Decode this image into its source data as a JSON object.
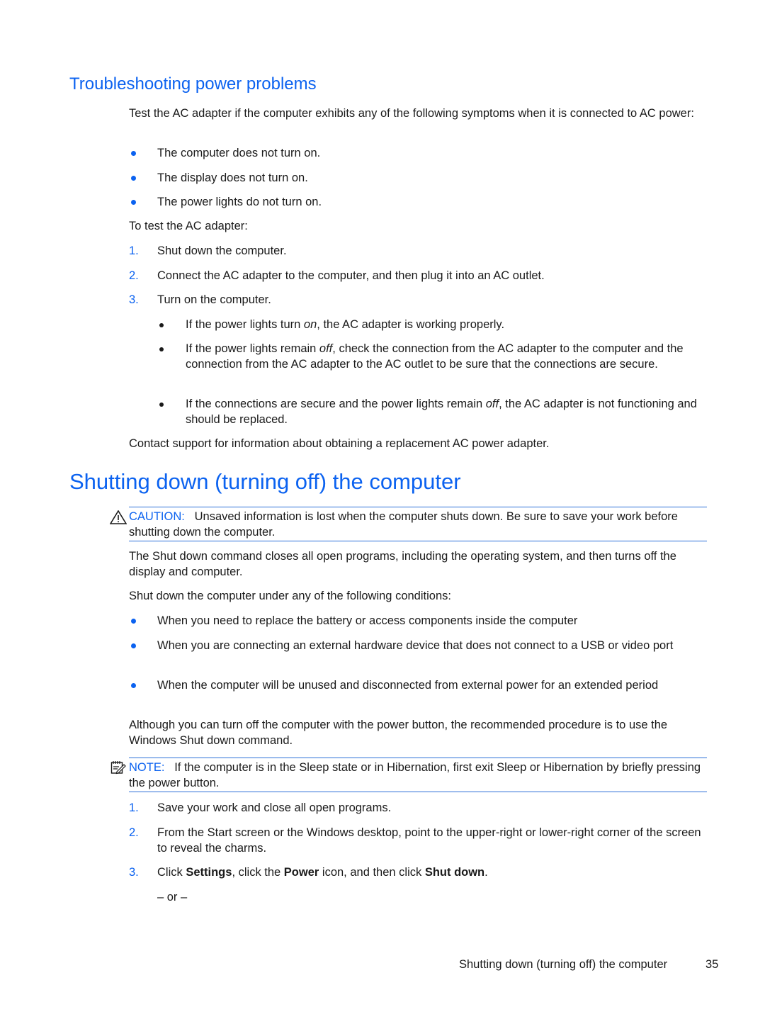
{
  "section_troubleshooting": {
    "heading": "Troubleshooting power problems",
    "intro": "Test the AC adapter if the computer exhibits any of the following symptoms when it is connected to AC power:",
    "symptoms": [
      "The computer does not turn on.",
      "The display does not turn on.",
      "The power lights do not turn on."
    ],
    "test_intro": "To test the AC adapter:",
    "steps": [
      {
        "num": "1.",
        "text": "Shut down the computer."
      },
      {
        "num": "2.",
        "text": "Connect the AC adapter to the computer, and then plug it into an AC outlet."
      },
      {
        "num": "3.",
        "text": "Turn on the computer."
      }
    ],
    "results": [
      {
        "before": "If the power lights turn ",
        "em": "on",
        "after": ", the AC adapter is working properly."
      },
      {
        "before": "If the power lights remain ",
        "em": "off",
        "after": ", check the connection from the AC adapter to the computer and the connection from the AC adapter to the AC outlet to be sure that the connections are secure."
      },
      {
        "before": "If the connections are secure and the power lights remain ",
        "em": "off",
        "after": ", the AC adapter is not functioning and should be replaced."
      }
    ],
    "contact": "Contact support for information about obtaining a replacement AC power adapter."
  },
  "section_shutdown": {
    "heading": "Shutting down (turning off) the computer",
    "caution": {
      "icon": "warning-triangle-icon",
      "label": "CAUTION:",
      "text": "Unsaved information is lost when the computer shuts down. Be sure to save your work before shutting down the computer."
    },
    "desc": "The Shut down command closes all open programs, including the operating system, and then turns off the display and computer.",
    "conditions_intro": "Shut down the computer under any of the following conditions:",
    "conditions": [
      "When you need to replace the battery or access components inside the computer",
      "When you are connecting an external hardware device that does not connect to a USB or video port",
      "When the computer will be unused and disconnected from external power for an extended period"
    ],
    "recommend": "Although you can turn off the computer with the power button, the recommended procedure is to use the Windows Shut down command.",
    "note": {
      "icon": "note-pad-icon",
      "label": "NOTE:",
      "text": "If the computer is in the Sleep state or in Hibernation, first exit Sleep or Hibernation by briefly pressing the power button."
    },
    "steps": [
      {
        "num": "1.",
        "text": "Save your work and close all open programs."
      },
      {
        "num": "2.",
        "text": "From the Start screen or the Windows desktop, point to the upper-right or lower-right corner of the screen to reveal the charms."
      },
      {
        "num": "3.",
        "parts": [
          "Click ",
          "Settings",
          ", click the ",
          "Power",
          " icon, and then click ",
          "Shut down",
          "."
        ]
      }
    ],
    "or": "– or –"
  },
  "footer": {
    "title": "Shutting down (turning off) the computer",
    "page": "35"
  }
}
